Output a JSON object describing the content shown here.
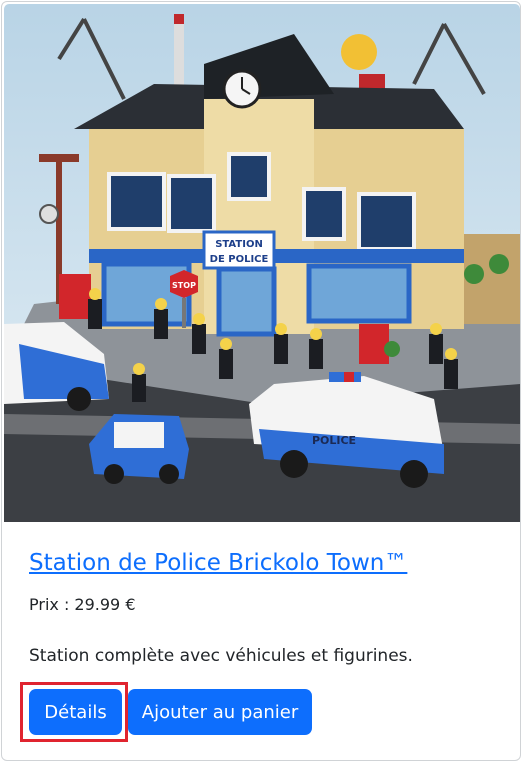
{
  "product": {
    "title": "Station de Police Brickolo Town™",
    "price_text": "Prix : 29.99 €",
    "description": "Station complète avec véhicules et figurines.",
    "image_signs": {
      "station_line1": "STATION",
      "station_line2": "DE POLICE",
      "stop": "STOP",
      "car_label": "POLICE"
    }
  },
  "actions": {
    "details_label": "Détails",
    "add_to_cart_label": "Ajouter au panier"
  },
  "colors": {
    "accent": "#0d6efd",
    "highlight": "#e0242f"
  }
}
